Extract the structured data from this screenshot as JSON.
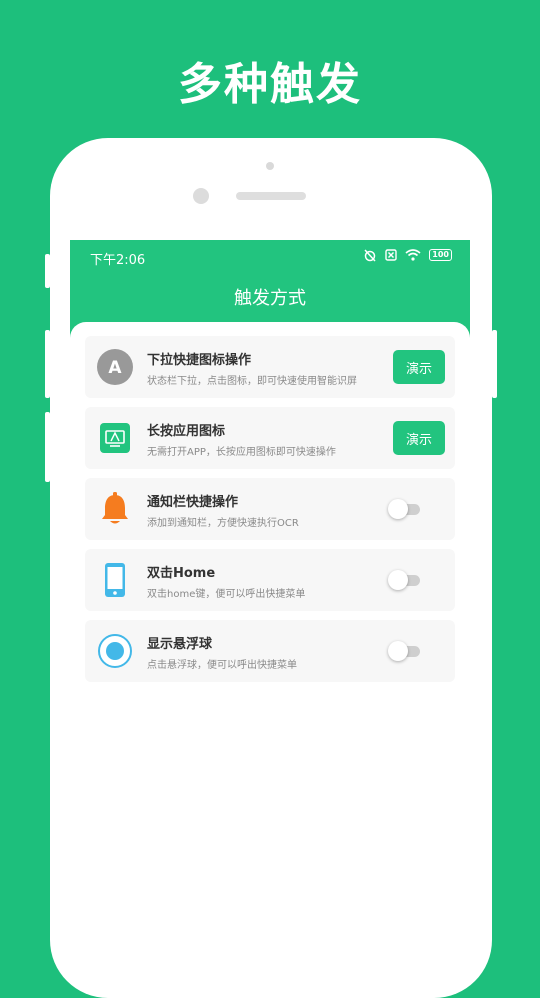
{
  "headline": "多种触发",
  "status_bar": {
    "time": "下午2:06",
    "battery": "100"
  },
  "app": {
    "title": "触发方式"
  },
  "options": [
    {
      "title": "下拉快捷图标操作",
      "desc": "状态栏下拉，点击图标，即可快速使用智能识屏",
      "action_label": "演示",
      "icon_letter": "A",
      "icon": "letter-a-icon"
    },
    {
      "title": "长按应用图标",
      "desc": "无需打开APP，长按应用图标即可快速操作",
      "action_label": "演示",
      "icon": "app-screen-icon"
    },
    {
      "title": "通知栏快捷操作",
      "desc": "添加到通知栏，方便快速执行OCR",
      "toggle_on": false,
      "icon": "bell-icon"
    },
    {
      "title": "双击Home",
      "desc": "双击home键，便可以呼出快捷菜单",
      "toggle_on": false,
      "icon": "phone-icon"
    },
    {
      "title": "显示悬浮球",
      "desc": "点击悬浮球，便可以呼出快捷菜单",
      "toggle_on": false,
      "icon": "floating-ball-icon"
    }
  ],
  "colors": {
    "brand_green": "#1dbf7c",
    "header_green": "#22c47f",
    "bell_orange": "#f57c1f",
    "phone_blue": "#43b8e8"
  }
}
